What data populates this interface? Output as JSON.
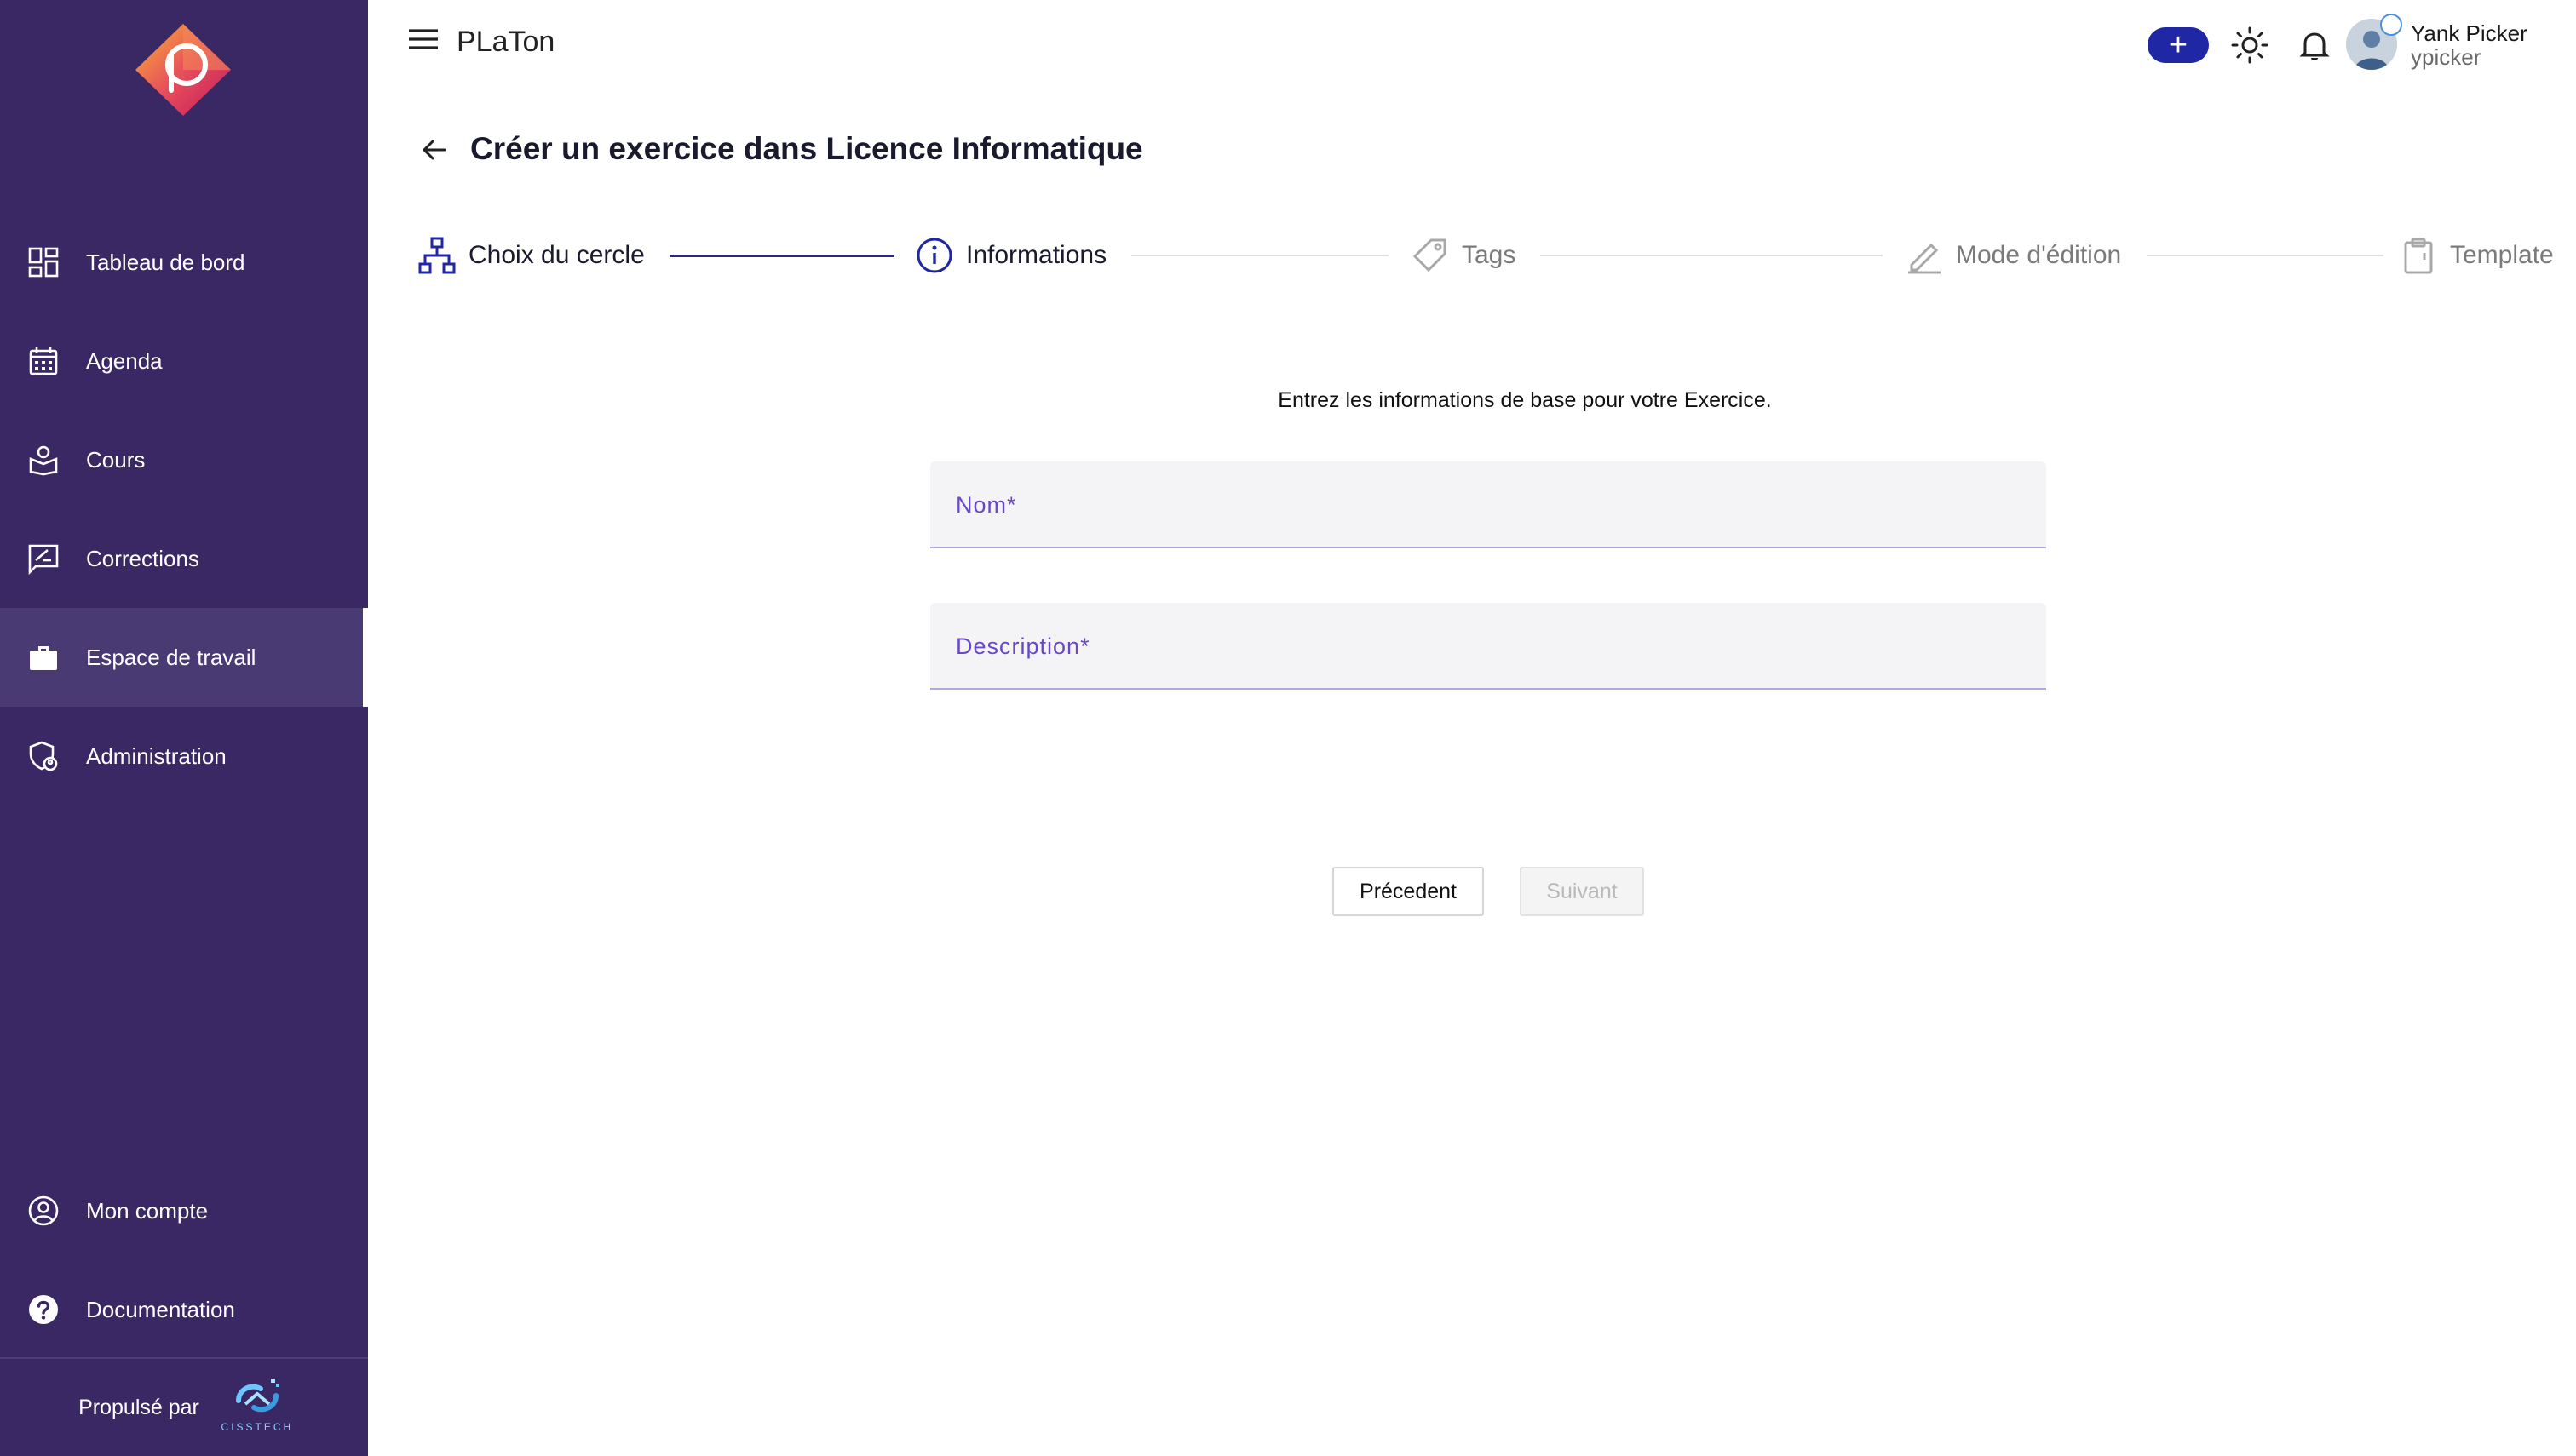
{
  "app": {
    "title": "PLaTon"
  },
  "sidebar": {
    "items": [
      {
        "label": "Tableau de bord",
        "icon": "dashboard-icon"
      },
      {
        "label": "Agenda",
        "icon": "calendar-icon"
      },
      {
        "label": "Cours",
        "icon": "course-icon"
      },
      {
        "label": "Corrections",
        "icon": "corrections-icon"
      },
      {
        "label": "Espace de travail",
        "icon": "briefcase-icon",
        "active": true
      },
      {
        "label": "Administration",
        "icon": "admin-icon"
      }
    ],
    "bottom_items": [
      {
        "label": "Mon compte",
        "icon": "account-icon"
      },
      {
        "label": "Documentation",
        "icon": "help-icon"
      }
    ],
    "powered_by": "Propulsé par",
    "powered_brand": "CISSTECH"
  },
  "topbar": {
    "add_label": "+",
    "user": {
      "name": "Yank Picker",
      "login": "ypicker"
    }
  },
  "page": {
    "title": "Créer un exercice dans Licence Informatique"
  },
  "stepper": {
    "steps": [
      {
        "label": "Choix du cercle",
        "icon": "hierarchy-icon",
        "state": "done"
      },
      {
        "label": "Informations",
        "icon": "info-icon",
        "state": "active"
      },
      {
        "label": "Tags",
        "icon": "tag-icon",
        "state": "pending"
      },
      {
        "label": "Mode d'édition",
        "icon": "pencil-icon",
        "state": "pending"
      },
      {
        "label": "Template",
        "icon": "clipboard-icon",
        "state": "pending"
      }
    ]
  },
  "form": {
    "hint": "Entrez les informations de base pour votre Exercice.",
    "name_label": "Nom",
    "name_value": "",
    "description_label": "Description",
    "description_value": "",
    "required_mark": "*"
  },
  "actions": {
    "previous_label": "Précedent",
    "next_label": "Suivant"
  },
  "colors": {
    "sidebar_bg": "#3a2865",
    "sidebar_active": "#4a3a74",
    "accent": "#1f27a4",
    "field_label": "#6848c9",
    "stepper_done": "#2a2a86"
  }
}
